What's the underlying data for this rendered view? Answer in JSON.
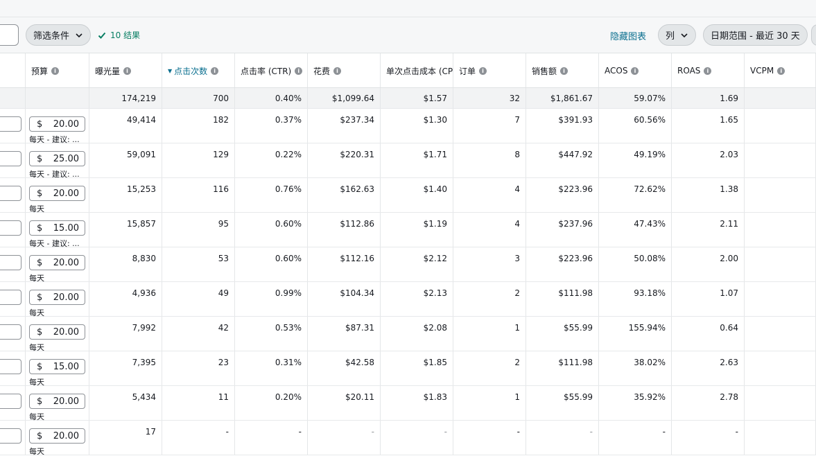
{
  "toolbar": {
    "filter_label": "筛选条件",
    "results_label": "10 结果",
    "hide_chart_label": "隐藏图表",
    "columns_label": "列",
    "date_range_label": "日期范围 - 最近 30 天"
  },
  "headers": [
    {
      "key": "budget",
      "label": "预算"
    },
    {
      "key": "impressions",
      "label": "曝光量"
    },
    {
      "key": "clicks",
      "label": "点击次数",
      "sorted": true
    },
    {
      "key": "ctr",
      "label": "点击率 (CTR)"
    },
    {
      "key": "spend",
      "label": "花费"
    },
    {
      "key": "cpc",
      "label": "单次点击成本 (CPC)"
    },
    {
      "key": "orders",
      "label": "订单"
    },
    {
      "key": "sales",
      "label": "销售额"
    },
    {
      "key": "acos",
      "label": "ACOS"
    },
    {
      "key": "roas",
      "label": "ROAS"
    },
    {
      "key": "vcpm",
      "label": "VCPM"
    }
  ],
  "totals": {
    "impressions": "174,219",
    "clicks": "700",
    "ctr": "0.40%",
    "spend": "$1,099.64",
    "cpc": "$1.57",
    "orders": "32",
    "sales": "$1,861.67",
    "acos": "59.07%",
    "roas": "1.69",
    "vcpm": ""
  },
  "rows": [
    {
      "currency": "$",
      "budget": "20.00",
      "budget_note": "每天 - 建议: ...",
      "impressions": "49,414",
      "clicks": "182",
      "ctr": "0.37%",
      "spend": "$237.34",
      "cpc": "$1.30",
      "orders": "7",
      "sales": "$391.93",
      "acos": "60.56%",
      "roas": "1.65",
      "vcpm": ""
    },
    {
      "currency": "$",
      "budget": "25.00",
      "budget_note": "每天 - 建议: ...",
      "impressions": "59,091",
      "clicks": "129",
      "ctr": "0.22%",
      "spend": "$220.31",
      "cpc": "$1.71",
      "orders": "8",
      "sales": "$447.92",
      "acos": "49.19%",
      "roas": "2.03",
      "vcpm": ""
    },
    {
      "currency": "$",
      "budget": "20.00",
      "budget_note": "每天",
      "impressions": "15,253",
      "clicks": "116",
      "ctr": "0.76%",
      "spend": "$162.63",
      "cpc": "$1.40",
      "orders": "4",
      "sales": "$223.96",
      "acos": "72.62%",
      "roas": "1.38",
      "vcpm": ""
    },
    {
      "currency": "$",
      "budget": "15.00",
      "budget_note": "每天 - 建议: ...",
      "impressions": "15,857",
      "clicks": "95",
      "ctr": "0.60%",
      "spend": "$112.86",
      "cpc": "$1.19",
      "orders": "4",
      "sales": "$237.96",
      "acos": "47.43%",
      "roas": "2.11",
      "vcpm": ""
    },
    {
      "currency": "$",
      "budget": "20.00",
      "budget_note": "每天",
      "impressions": "8,830",
      "clicks": "53",
      "ctr": "0.60%",
      "spend": "$112.16",
      "cpc": "$2.12",
      "orders": "3",
      "sales": "$223.96",
      "acos": "50.08%",
      "roas": "2.00",
      "vcpm": ""
    },
    {
      "currency": "$",
      "budget": "20.00",
      "budget_note": "每天",
      "impressions": "4,936",
      "clicks": "49",
      "ctr": "0.99%",
      "spend": "$104.34",
      "cpc": "$2.13",
      "orders": "2",
      "sales": "$111.98",
      "acos": "93.18%",
      "roas": "1.07",
      "vcpm": ""
    },
    {
      "currency": "$",
      "budget": "20.00",
      "budget_note": "每天",
      "impressions": "7,992",
      "clicks": "42",
      "ctr": "0.53%",
      "spend": "$87.31",
      "cpc": "$2.08",
      "orders": "1",
      "sales": "$55.99",
      "acos": "155.94%",
      "roas": "0.64",
      "vcpm": ""
    },
    {
      "currency": "$",
      "budget": "15.00",
      "budget_note": "每天",
      "impressions": "7,395",
      "clicks": "23",
      "ctr": "0.31%",
      "spend": "$42.58",
      "cpc": "$1.85",
      "orders": "2",
      "sales": "$111.98",
      "acos": "38.02%",
      "roas": "2.63",
      "vcpm": ""
    },
    {
      "currency": "$",
      "budget": "20.00",
      "budget_note": "每天",
      "impressions": "5,434",
      "clicks": "11",
      "ctr": "0.20%",
      "spend": "$20.11",
      "cpc": "$1.83",
      "orders": "1",
      "sales": "$55.99",
      "acos": "35.92%",
      "roas": "2.78",
      "vcpm": ""
    },
    {
      "currency": "$",
      "budget": "20.00",
      "budget_note": "每天",
      "impressions": "17",
      "clicks": "-",
      "ctr": "-",
      "spend": "-",
      "cpc": "-",
      "orders": "-",
      "sales": "-",
      "acos": "-",
      "roas": "-",
      "vcpm": ""
    }
  ]
}
